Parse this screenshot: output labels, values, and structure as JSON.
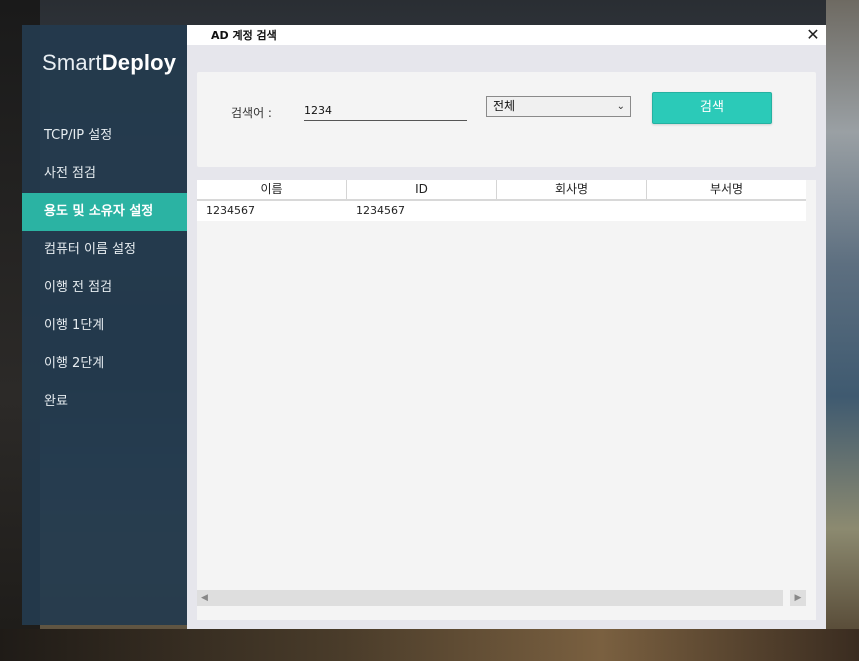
{
  "app": {
    "logo_light": "Smart",
    "logo_bold": "Deploy"
  },
  "sidebar": {
    "items": [
      {
        "label": "TCP/IP 설정",
        "active": false
      },
      {
        "label": "사전 점검",
        "active": false
      },
      {
        "label": "용도 및 소유자 설정",
        "active": true
      },
      {
        "label": "컴퓨터 이름 설정",
        "active": false
      },
      {
        "label": "이행 전 점검",
        "active": false
      },
      {
        "label": "이행 1단계",
        "active": false
      },
      {
        "label": "이행 2단계",
        "active": false
      },
      {
        "label": "완료",
        "active": false
      }
    ]
  },
  "dialog": {
    "title": "AD 계정 검색",
    "close_glyph": "✕"
  },
  "search": {
    "label": "검색어 :",
    "value": "1234",
    "scope_selected": "전체",
    "button_label": "검색"
  },
  "results": {
    "columns": [
      "이름",
      "ID",
      "회사명",
      "부서명"
    ],
    "rows": [
      [
        "1234567",
        "1234567",
        "",
        ""
      ]
    ]
  },
  "colors": {
    "accent": "#2bcab8",
    "sidebar_active": "#2bb3a3",
    "sidebar_bg": "#243a4e"
  }
}
